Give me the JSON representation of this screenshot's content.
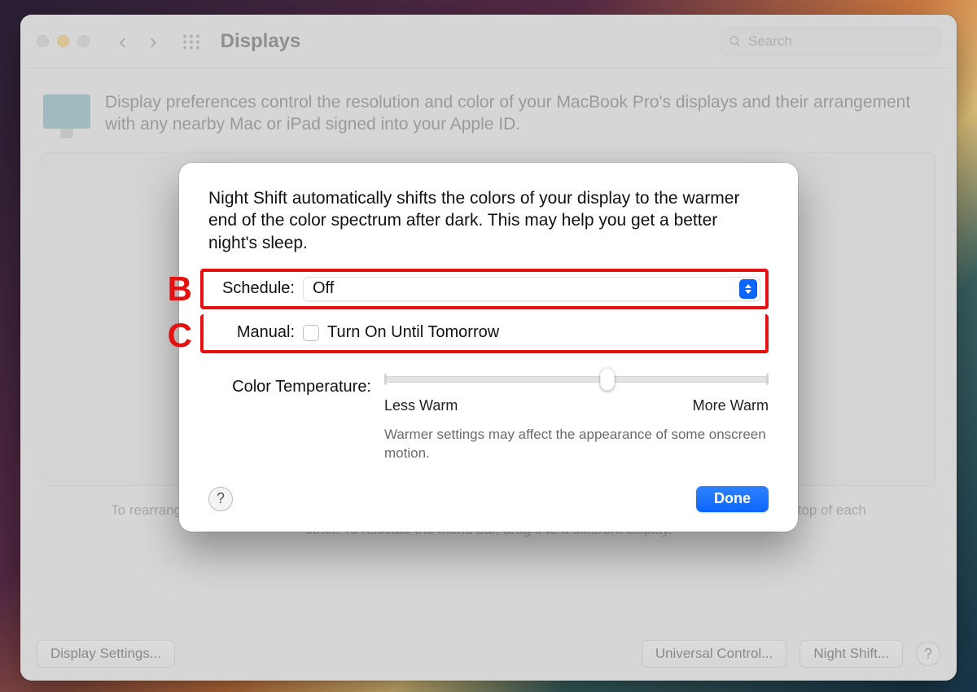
{
  "toolbar": {
    "title": "Displays",
    "search_placeholder": "Search"
  },
  "intro": {
    "text": "Display preferences control the resolution and color of your MacBook Pro's displays and their arrangement with any nearby Mac or iPad signed into your Apple ID."
  },
  "arrangement_hint": "To rearrange displays, drag them to the desired position. To mirror displays, hold Option while dragging them on top of each other. To relocate the menu bar, drag it to a different display.",
  "footer": {
    "display_settings": "Display Settings...",
    "universal_control": "Universal Control...",
    "night_shift": "Night Shift..."
  },
  "sheet": {
    "description": "Night Shift automatically shifts the colors of your display to the warmer end of the color spectrum after dark. This may help you get a better night's sleep.",
    "annotations": {
      "b": "B",
      "c": "C"
    },
    "schedule": {
      "label": "Schedule:",
      "value": "Off"
    },
    "manual": {
      "label": "Manual:",
      "checkbox_label": "Turn On Until Tomorrow"
    },
    "color_temp": {
      "label": "Color Temperature:",
      "less": "Less Warm",
      "more": "More Warm",
      "hint": "Warmer settings may affect the appearance of some onscreen motion."
    },
    "done": "Done",
    "help": "?"
  }
}
